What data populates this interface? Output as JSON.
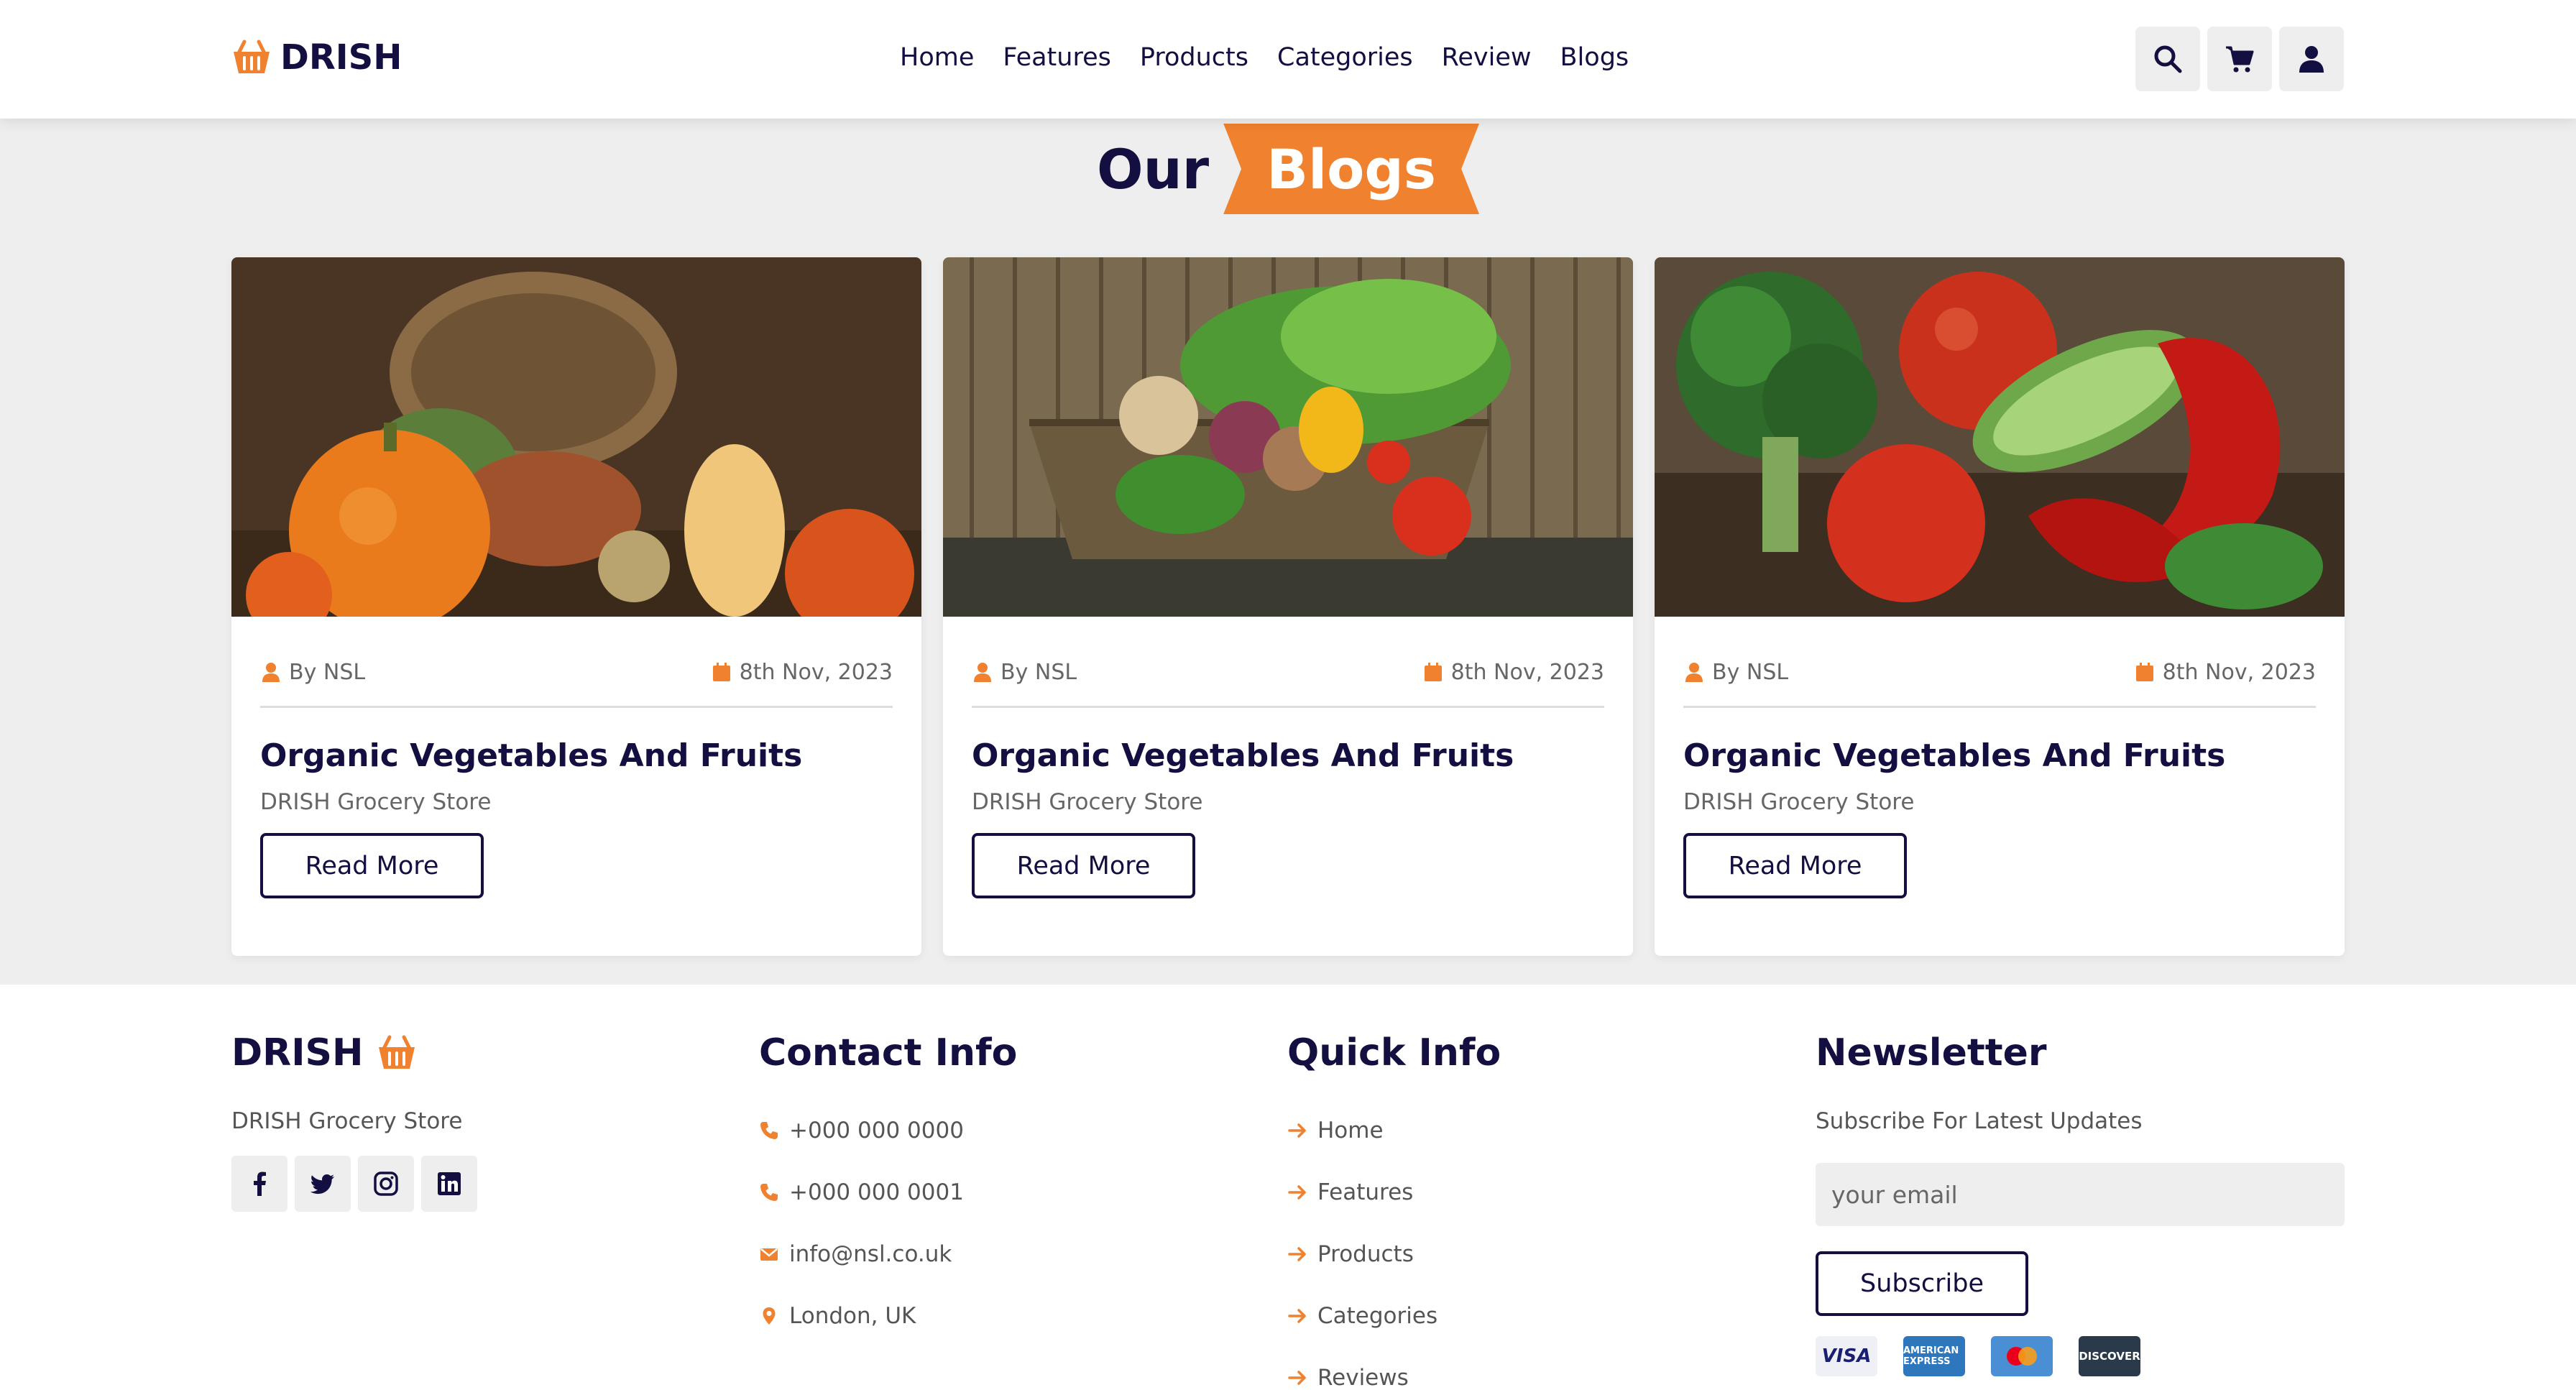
{
  "header": {
    "logo_text": "DRISH",
    "nav": [
      "Home",
      "Features",
      "Products",
      "Categories",
      "Review",
      "Blogs"
    ],
    "icons": [
      "search-icon",
      "cart-icon",
      "user-icon"
    ]
  },
  "heading": {
    "part1": "Our",
    "part2": "Blogs"
  },
  "blogs": [
    {
      "author": "By NSL",
      "date": "8th Nov, 2023",
      "title": "Organic Vegetables And Fruits",
      "subtitle": "DRISH Grocery Store",
      "button": "Read More"
    },
    {
      "author": "By NSL",
      "date": "8th Nov, 2023",
      "title": "Organic Vegetables And Fruits",
      "subtitle": "DRISH Grocery Store",
      "button": "Read More"
    },
    {
      "author": "By NSL",
      "date": "8th Nov, 2023",
      "title": "Organic Vegetables And Fruits",
      "subtitle": "DRISH Grocery Store",
      "button": "Read More"
    }
  ],
  "footer": {
    "brand": {
      "title": "DRISH",
      "text": "DRISH Grocery Store",
      "social": [
        "facebook-icon",
        "twitter-icon",
        "instagram-icon",
        "linkedin-icon"
      ]
    },
    "contact": {
      "title": "Contact Info",
      "items": [
        "+000 000 0000",
        "+000 000 0001",
        "info@nsl.co.uk",
        "London, UK"
      ]
    },
    "quick": {
      "title": "Quick Info",
      "items": [
        "Home",
        "Features",
        "Products",
        "Categories",
        "Reviews"
      ]
    },
    "newsletter": {
      "title": "Newsletter",
      "text": "Subscribe For Latest Updates",
      "placeholder": "your email",
      "button": "Subscribe",
      "payments": [
        "VISA",
        "AMEX",
        "MASTERCARD",
        "DISCOVER"
      ]
    }
  },
  "colors": {
    "accent": "#f0812e",
    "dark": "#130f40",
    "background": "#eeeeee"
  }
}
